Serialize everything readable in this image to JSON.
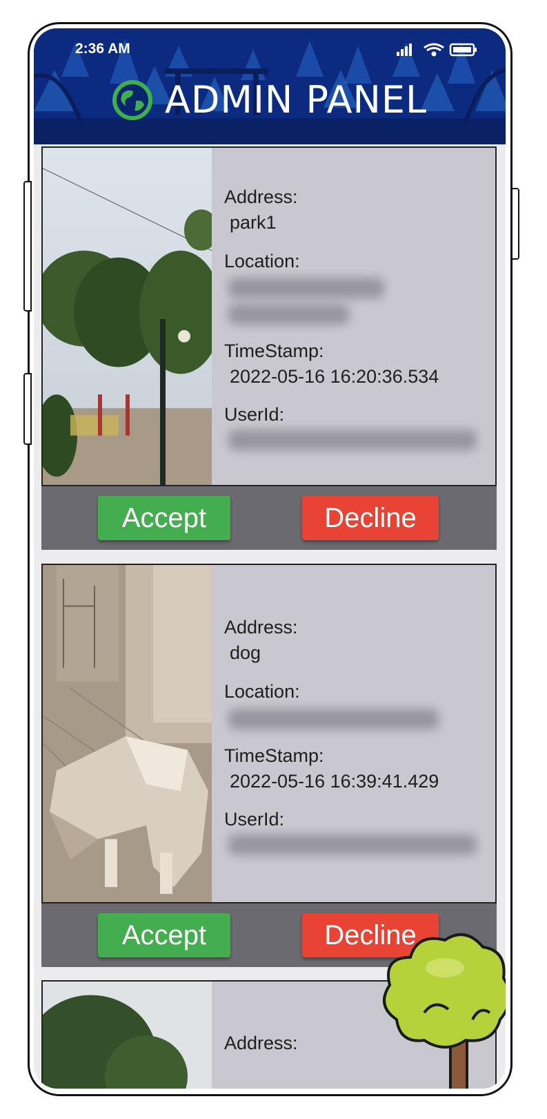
{
  "status_bar": {
    "time": "2:36 AM"
  },
  "header": {
    "title": "ADMIN PANEL"
  },
  "cards": [
    {
      "address_label": "Address:",
      "address": "park1",
      "location_label": "Location:",
      "timestamp_label": "TimeStamp:",
      "timestamp": "2022-05-16 16:20:36.534",
      "userid_label": "UserId:",
      "accept_label": "Accept",
      "decline_label": "Decline"
    },
    {
      "address_label": "Address:",
      "address": "dog",
      "location_label": "Location:",
      "timestamp_label": "TimeStamp:",
      "timestamp": "2022-05-16 16:39:41.429",
      "userid_label": "UserId:",
      "accept_label": "Accept",
      "decline_label": "Decline"
    },
    {
      "address_label": "Address:"
    }
  ],
  "colors": {
    "header_bg": "#0b2470",
    "accept": "#43ad4f",
    "decline": "#e94335",
    "card_bg": "#c9c7cf",
    "action_bar": "#6b6a70"
  },
  "icons": [
    "globe-icon",
    "signal-icon",
    "wifi-icon",
    "battery-icon"
  ]
}
